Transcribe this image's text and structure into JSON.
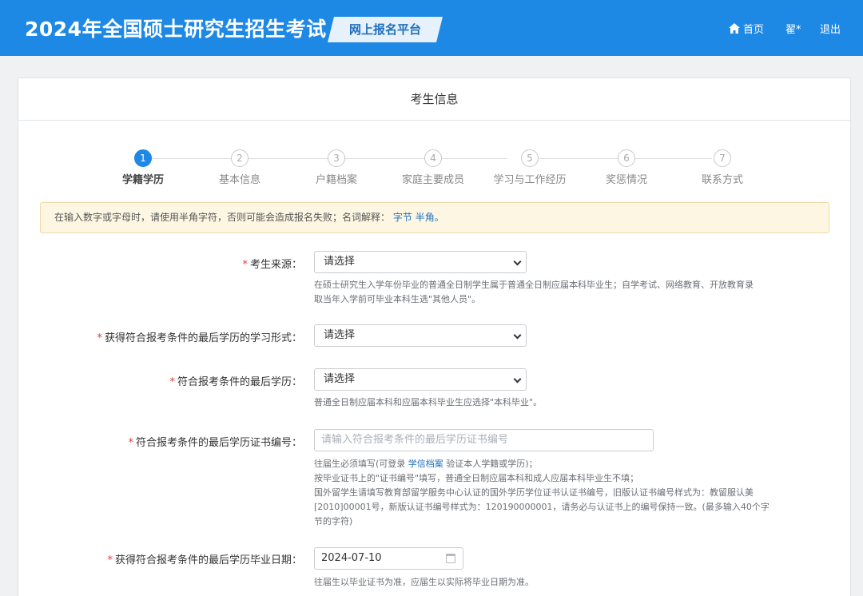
{
  "header": {
    "title": "2024年全国硕士研究生招生考试",
    "platform": "网上报名平台",
    "home": "首页",
    "user": "翟*",
    "logout": "退出"
  },
  "card": {
    "title": "考生信息"
  },
  "steps": [
    {
      "num": "1",
      "label": "学籍学历",
      "active": true
    },
    {
      "num": "2",
      "label": "基本信息"
    },
    {
      "num": "3",
      "label": "户籍档案"
    },
    {
      "num": "4",
      "label": "家庭主要成员"
    },
    {
      "num": "5",
      "label": "学习与工作经历"
    },
    {
      "num": "6",
      "label": "奖惩情况"
    },
    {
      "num": "7",
      "label": "联系方式"
    }
  ],
  "notice": {
    "text": "在输入数字或字母时，请使用半角字符，否则可能会造成报名失败；名词解释：",
    "link1": "字节",
    "link2": "半角",
    "end": "。"
  },
  "form": {
    "source": {
      "required": "*",
      "label": "考生来源：",
      "value": "请选择",
      "help": "在硕士研究生入学年份毕业的普通全日制学生属于普通全日制应届本科毕业生；自学考试、网络教育、开放教育录取当年入学前可毕业本科生选\"其他人员\"。"
    },
    "study_form": {
      "required": "*",
      "label": "获得符合报考条件的最后学历的学习形式：",
      "value": "请选择"
    },
    "last_degree": {
      "required": "*",
      "label": "符合报考条件的最后学历：",
      "value": "请选择",
      "help": "普通全日制应届本科和应届本科毕业生应选择\"本科毕业\"。"
    },
    "cert_no": {
      "required": "*",
      "label": "符合报考条件的最后学历证书编号：",
      "placeholder": "请输入符合报考条件的最后学历证书编号",
      "help1a": "往届生必须填写(可登录 ",
      "help1link": "学信档案",
      "help1b": " 验证本人学籍或学历)；",
      "help2": "按毕业证书上的\"证书编号\"填写，普通全日制应届本科和成人应届本科毕业生不填；",
      "help3": "国外留学生请填写教育部留学服务中心认证的国外学历学位证书认证书编号，旧版认证书编号样式为：教留服认美[2010]00001号，新版认证书编号样式为：120190000001，请务必与认证书上的编号保持一致。(最多输入40个字节的字符)"
    },
    "grad_date": {
      "required": "*",
      "label": "获得符合报考条件的最后学历毕业日期：",
      "value": "2024-07-10",
      "help": "往届生以毕业证书为准，应届生以实际将毕业日期为准。"
    }
  }
}
